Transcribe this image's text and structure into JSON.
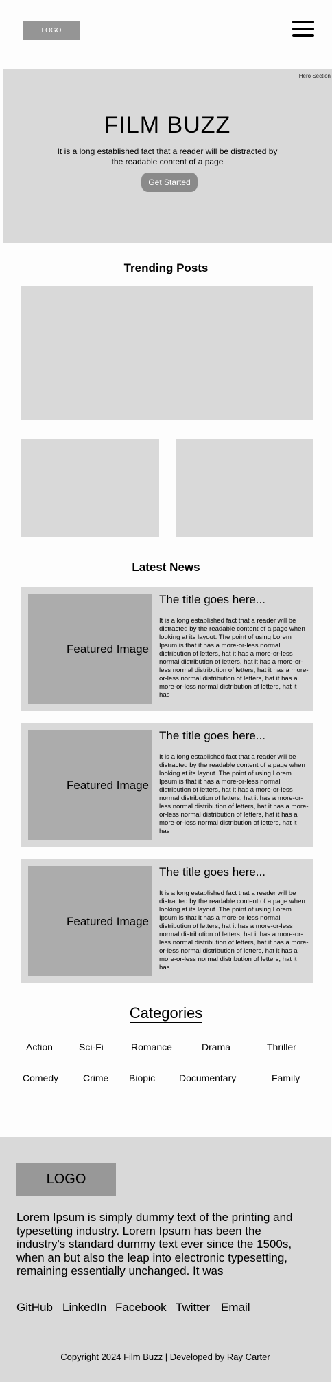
{
  "header": {
    "logo": "LOGO",
    "menu_icon": "hamburger-menu-icon"
  },
  "hero": {
    "section_tag": "Hero Section",
    "title": "FILM BUZZ",
    "subtitle": "It is a long established fact that a reader will be distracted by the readable content of a page",
    "cta": "Get Started"
  },
  "trending": {
    "title": "Trending Posts"
  },
  "latest": {
    "title": "Latest News",
    "items": [
      {
        "image_label": "Featured Image",
        "title": "The title goes here...",
        "text": "It is a long established fact that a reader will be distracted by the readable content of a page when looking at its layout. The point of using Lorem Ipsum is that it has a more-or-less normal distribution of letters, hat it has a more-or-less normal distribution of letters, hat it has a more-or-less normal distribution of letters,  hat it has a more-or-less normal distribution of letters, hat it has a more-or-less normal distribution of letters, hat it has"
      },
      {
        "image_label": "Featured Image",
        "title": "The title goes here...",
        "text": "It is a long established fact that a reader will be distracted by the readable content of a page when looking at its layout. The point of using Lorem Ipsum is that it has a more-or-less normal distribution of letters, hat it has a more-or-less normal distribution of letters, hat it has a more-or-less normal distribution of letters,  hat it has a more-or-less normal distribution of letters, hat it has a more-or-less normal distribution of letters, hat it has"
      },
      {
        "image_label": "Featured Image",
        "title": "The title goes here...",
        "text": "It is a long established fact that a reader will be distracted by the readable content of a page when looking at its layout. The point of using Lorem Ipsum is that it has a more-or-less normal distribution of letters, hat it has a more-or-less normal distribution of letters, hat it has a more-or-less normal distribution of letters,  hat it has a more-or-less normal distribution of letters, hat it has a more-or-less normal distribution of letters, hat it has"
      }
    ]
  },
  "categories": {
    "title": "Categories",
    "items": [
      "Action",
      "Sci-Fi",
      "Romance",
      "Drama",
      "Thriller",
      "Comedy",
      "Crime",
      "Biopic",
      "Documentary",
      "Family"
    ]
  },
  "footer": {
    "logo": "LOGO",
    "text": "Lorem Ipsum is simply dummy text of the printing and typesetting industry. Lorem Ipsum has been the industry's standard dummy text ever since the 1500s, when an but also the leap into electronic typesetting, remaining essentially unchanged. It was",
    "links": [
      "GitHub",
      "LinkedIn",
      "Facebook",
      "Twitter",
      "Email"
    ],
    "copyright": "Copyright 2024 Film Buzz | Developed by Ray Carter"
  }
}
